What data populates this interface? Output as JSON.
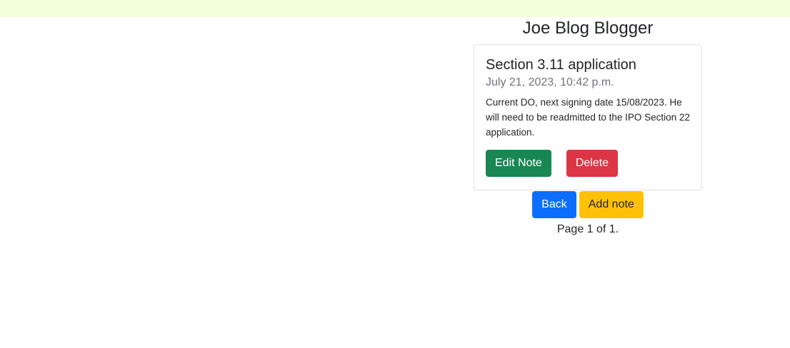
{
  "header": {
    "title": "Joe Blog Blogger"
  },
  "note": {
    "title": "Section 3.11 application",
    "date": "July 21, 2023, 10:42 p.m.",
    "body": "Current DO, next signing date 15/08/2023. He will need to be readmitted to the IPO Section 22 application.",
    "edit_label": "Edit Note",
    "delete_label": "Delete"
  },
  "actions": {
    "back_label": "Back",
    "add_label": "Add note"
  },
  "pagination": {
    "text": "Page 1 of 1."
  },
  "colors": {
    "top_strip": "#f3fedc",
    "success": "#198754",
    "danger": "#dc3545",
    "primary": "#0d6efd",
    "warning": "#ffc107"
  }
}
